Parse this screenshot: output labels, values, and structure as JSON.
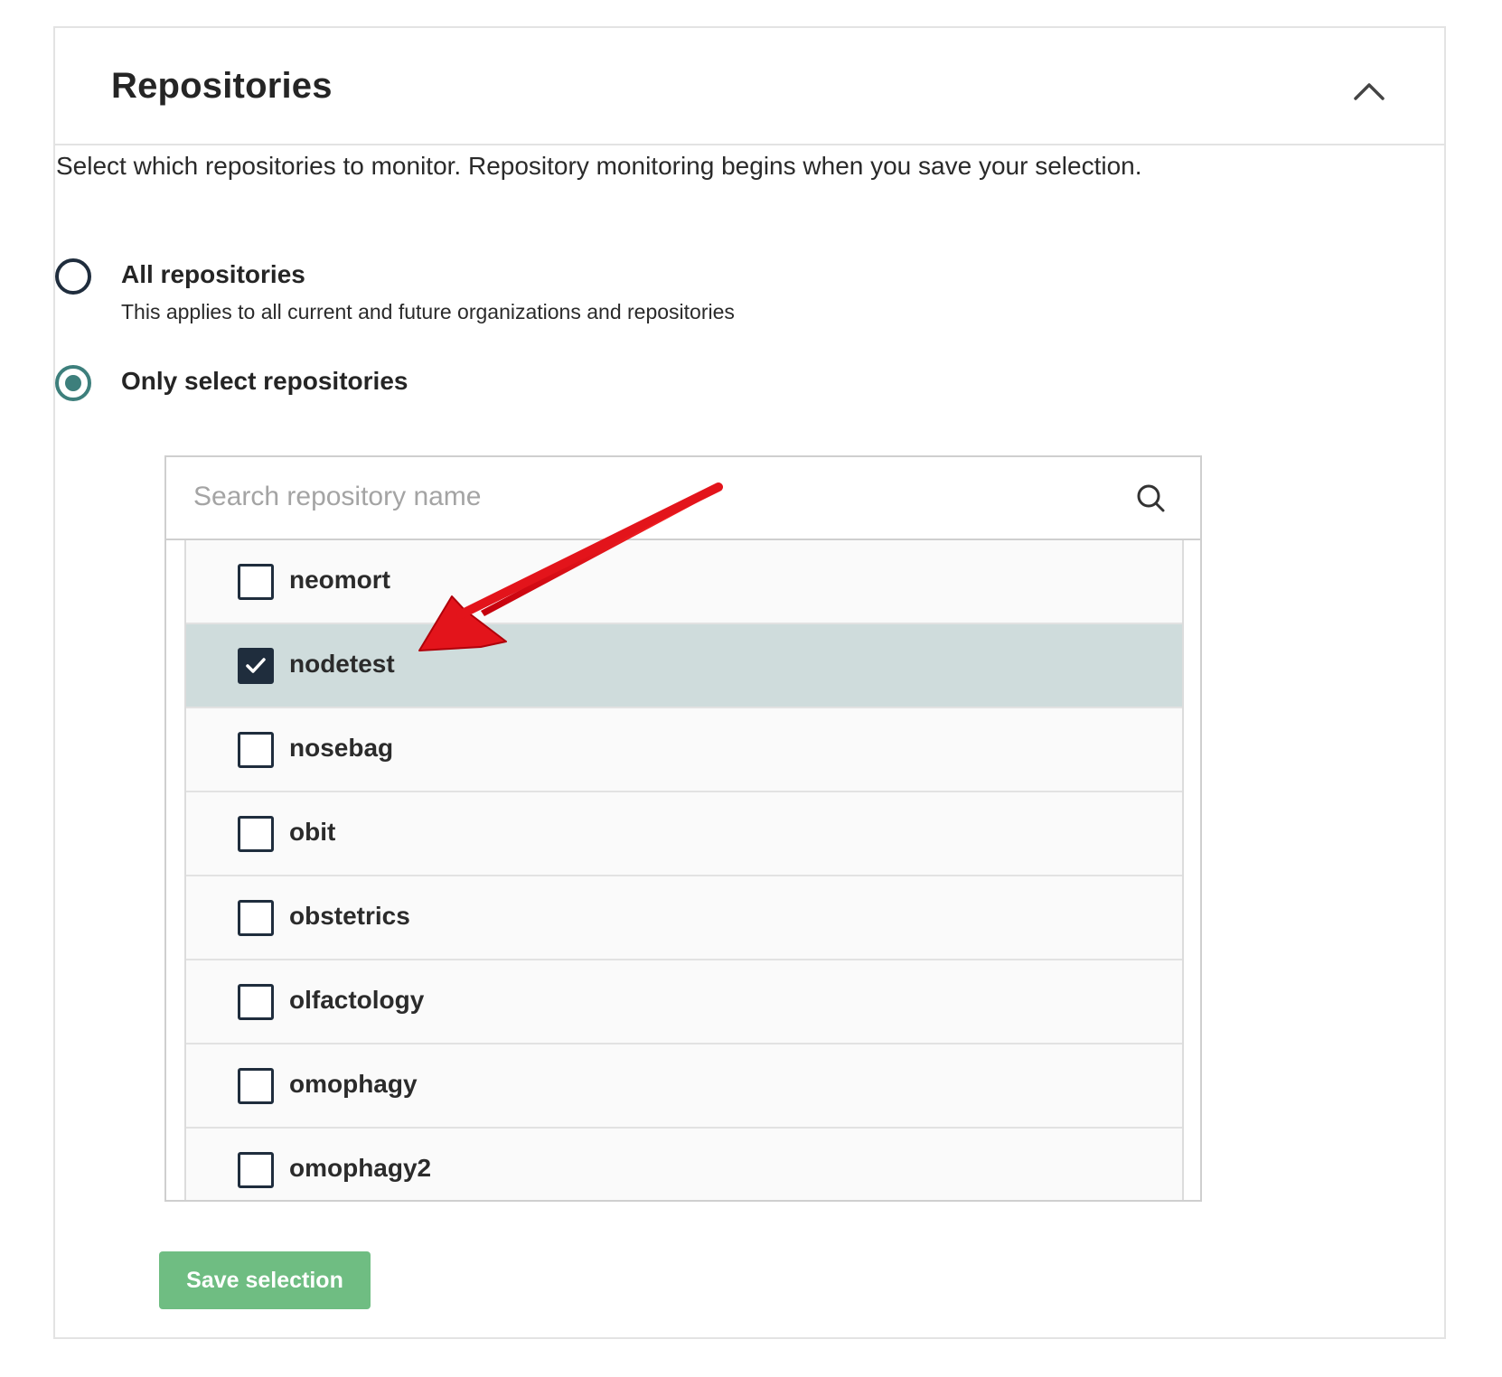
{
  "section": {
    "title": "Repositories",
    "description": "Select which repositories to monitor. Repository monitoring begins when you save your selection."
  },
  "options": {
    "all": {
      "label": "All repositories",
      "sublabel": "This applies to all current and future organizations and repositories",
      "checked": false
    },
    "select": {
      "label": "Only select repositories",
      "checked": true
    }
  },
  "search": {
    "placeholder": "Search repository name",
    "value": ""
  },
  "repositories": [
    {
      "name": "neomort",
      "checked": false
    },
    {
      "name": "nodetest",
      "checked": true
    },
    {
      "name": "nosebag",
      "checked": false
    },
    {
      "name": "obit",
      "checked": false
    },
    {
      "name": "obstetrics",
      "checked": false
    },
    {
      "name": "olfactology",
      "checked": false
    },
    {
      "name": "omophagy",
      "checked": false
    },
    {
      "name": "omophagy2",
      "checked": false
    }
  ],
  "actions": {
    "save_label": "Save selection"
  },
  "colors": {
    "accent_teal": "#3d7f7c",
    "selected_row": "#cfdcdc",
    "save_green": "#6fbd82",
    "annotation_red": "#e3141b"
  },
  "icons": {
    "collapse": "chevron-up-icon",
    "search": "search-icon",
    "check": "checkmark-icon",
    "annotation": "red-arrow-icon"
  }
}
